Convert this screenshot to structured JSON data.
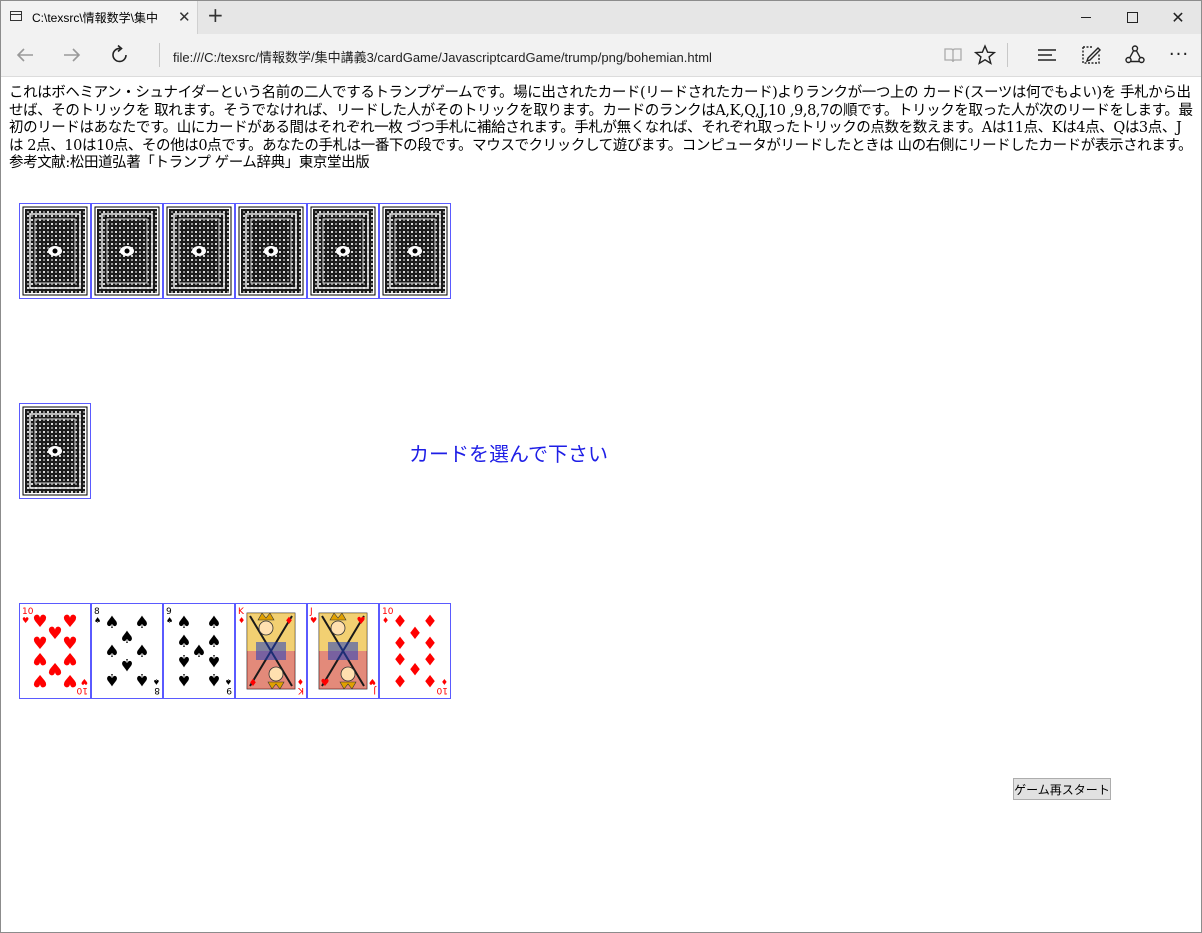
{
  "browser": {
    "tab_title": "C:\\texsrc\\情報数学\\集中",
    "tab_close_glyph": "✕",
    "new_tab_glyph": "+",
    "window_close_glyph": "✕",
    "address": "file:///C:/texsrc/情報数学/集中講義3/cardGame/JavascriptcardGame/trump/png/bohemian.html",
    "more_glyph": "···"
  },
  "page": {
    "intro": "これはボヘミアン・シュナイダーという名前の二人でするトランプゲームです。場に出されたカード(リードされたカード)よりランクが一つ上の カード(スーツは何でもよい)を 手札から出せば、そのトリックを 取れます。そうでなければ、リードした人がそのトリックを取ります。カードのランクはA,K,Q,J,10 ,9,8,7の順です。トリックを取った人が次のリードをします。最初のリードはあなたです。山にカードがある間はそれぞれ一枚 づつ手札に補給されます。手札が無くなれば、それぞれ取ったトリックの点数を数えます。Aは11点、Kは4点、Qは3点、Jは 2点、10は10点、その他は0点です。あなたの手札は一番下の段です。マウスでクリックして遊びます。コンピュータがリードしたときは 山の右側にリードしたカードが表示されます。参考文献:松田道弘著「トランプ ゲーム辞典」東京堂出版",
    "status_message": "カードを選んで下さい",
    "restart_label": "ゲーム再スタート"
  },
  "game": {
    "computer_hand_count": 6,
    "stock_count": 1,
    "player_hand": [
      {
        "rank": "10",
        "suit": "hearts",
        "suit_symbol": "♥",
        "color": "#ff0000"
      },
      {
        "rank": "8",
        "suit": "spades",
        "suit_symbol": "♠",
        "color": "#000000"
      },
      {
        "rank": "9",
        "suit": "spades",
        "suit_symbol": "♠",
        "color": "#000000"
      },
      {
        "rank": "K",
        "suit": "diamonds",
        "suit_symbol": "♦",
        "color": "#ff0000"
      },
      {
        "rank": "J",
        "suit": "hearts",
        "suit_symbol": "♥",
        "color": "#ff0000"
      },
      {
        "rank": "10",
        "suit": "diamonds",
        "suit_symbol": "♦",
        "color": "#ff0000"
      }
    ]
  },
  "colors": {
    "card_border": "#5a5aff",
    "status_text": "#1e1ee6",
    "red_suit": "#ff0000",
    "black_suit": "#000000"
  }
}
